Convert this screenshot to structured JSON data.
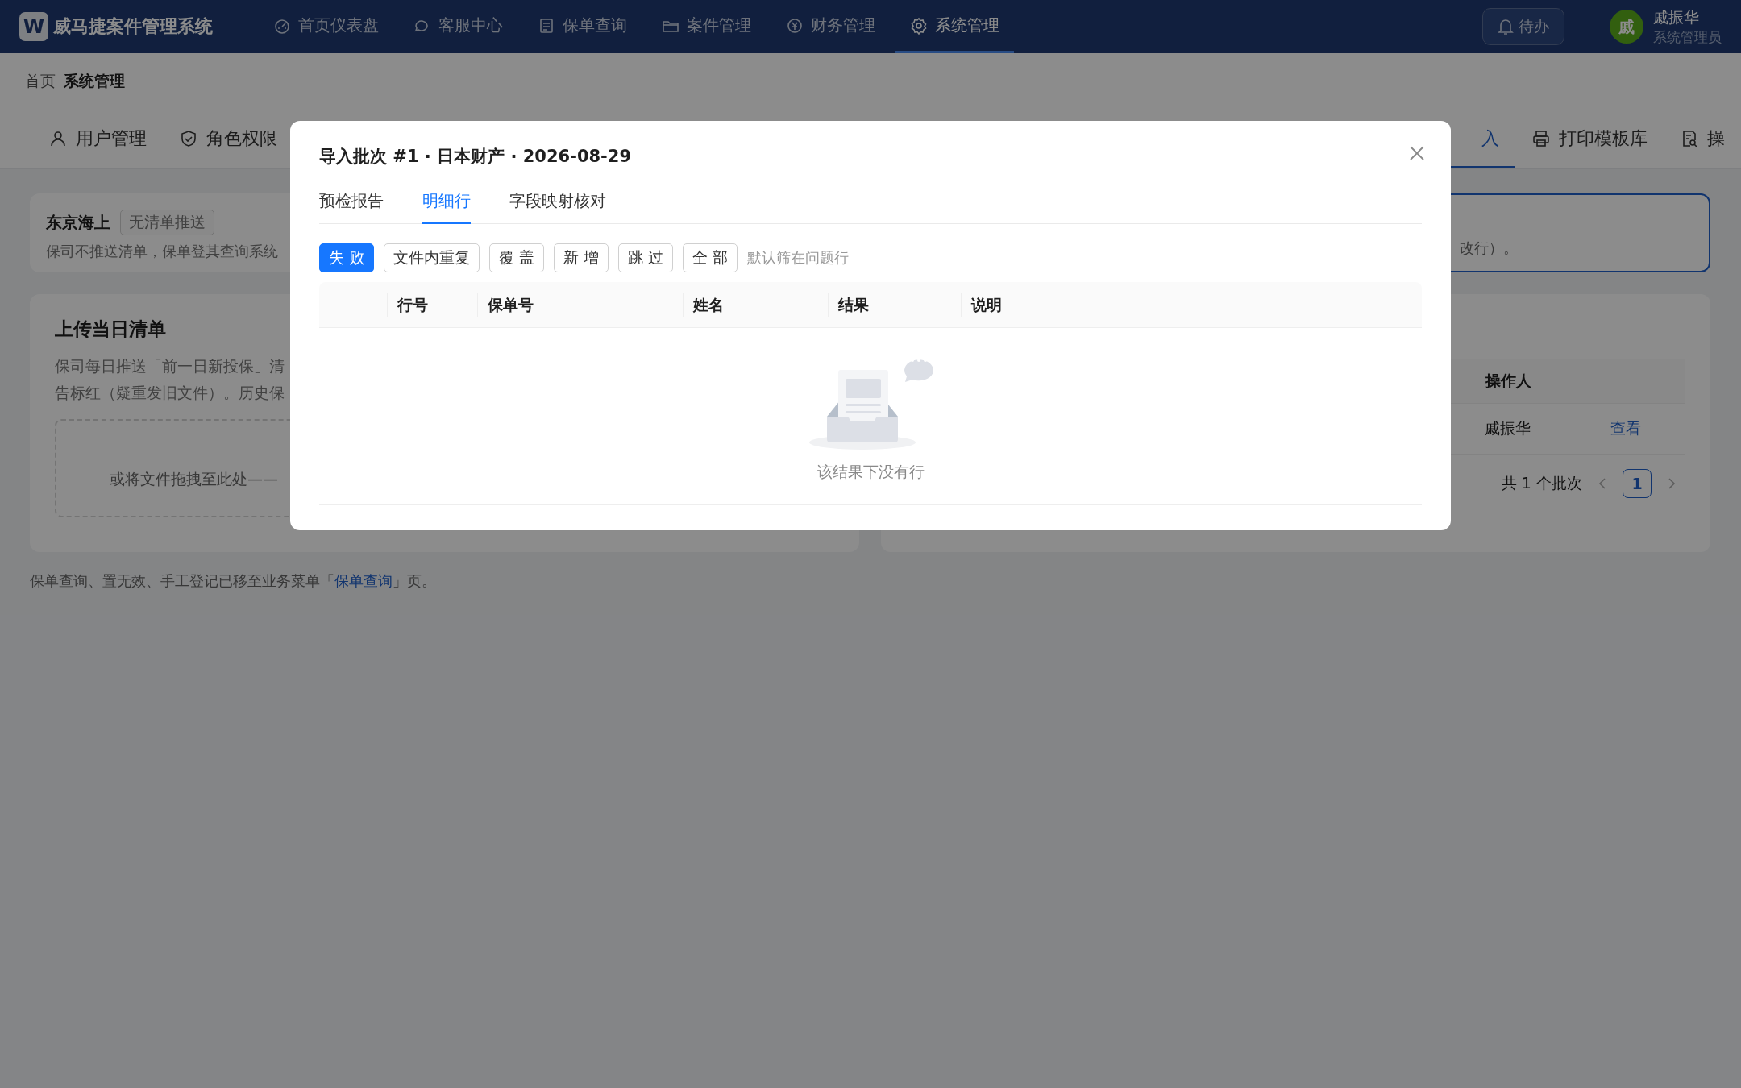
{
  "app": {
    "logo": "W",
    "title": "威马捷案件管理系统"
  },
  "nav": [
    {
      "label": "首页仪表盘",
      "selected": false
    },
    {
      "label": "客服中心",
      "selected": false
    },
    {
      "label": "保单查询",
      "selected": false
    },
    {
      "label": "案件管理",
      "selected": false
    },
    {
      "label": "财务管理",
      "selected": false
    },
    {
      "label": "系统管理",
      "selected": true
    }
  ],
  "todo_button": "待办",
  "user": {
    "avatar": "戚",
    "name": "戚振华",
    "role": "系统管理员"
  },
  "breadcrumb": [
    "首页",
    "系统管理"
  ],
  "tabs_left": [
    {
      "label": "用户管理",
      "selected": false
    },
    {
      "label": "角色权限",
      "selected": false
    }
  ],
  "tabs_right": [
    {
      "label": "入",
      "selected": true
    },
    {
      "label": "打印模板库",
      "selected": false
    },
    {
      "label": "操",
      "selected": false
    }
  ],
  "insurer_card": {
    "name": "东京海上",
    "tag": "无清单推送",
    "description": "保司不推送清单，保单登其查询系统"
  },
  "notice_card": {
    "text": "改行）。"
  },
  "upload_card": {
    "title": "上传当日清单",
    "description_lines": [
      "保司每日推送「前一日新投保」清",
      "告标红（疑重发旧文件）。历史保"
    ],
    "dropzone": "或将文件拖拽至此处——"
  },
  "batch_card": {
    "columns": [
      "操作人"
    ],
    "rows": [
      {
        "operator": "戚振华",
        "action": "查看"
      }
    ],
    "total": "共 1 个批次",
    "pages": [
      {
        "label": "1",
        "selected": true
      }
    ]
  },
  "footnote": {
    "before": "保单查询、置无效、手工登记已移至业务菜单「",
    "link": "保单查询",
    "after": "」页。"
  },
  "modal": {
    "title": "导入批次 #1 · 日本财产 · 2026-08-29",
    "tabs": [
      {
        "label": "预检报告",
        "selected": false
      },
      {
        "label": "明细行",
        "selected": true
      },
      {
        "label": "字段映射核对",
        "selected": false
      }
    ],
    "filters": [
      {
        "label": "失 败",
        "selected": true
      },
      {
        "label": "文件内重复",
        "selected": false
      },
      {
        "label": "覆 盖",
        "selected": false
      },
      {
        "label": "新 增",
        "selected": false
      },
      {
        "label": "跳 过",
        "selected": false
      },
      {
        "label": "全 部",
        "selected": false
      }
    ],
    "filter_hint": "默认筛在问题行",
    "columns": [
      "行号",
      "保单号",
      "姓名",
      "结果",
      "说明"
    ],
    "empty_text": "该结果下没有行"
  }
}
